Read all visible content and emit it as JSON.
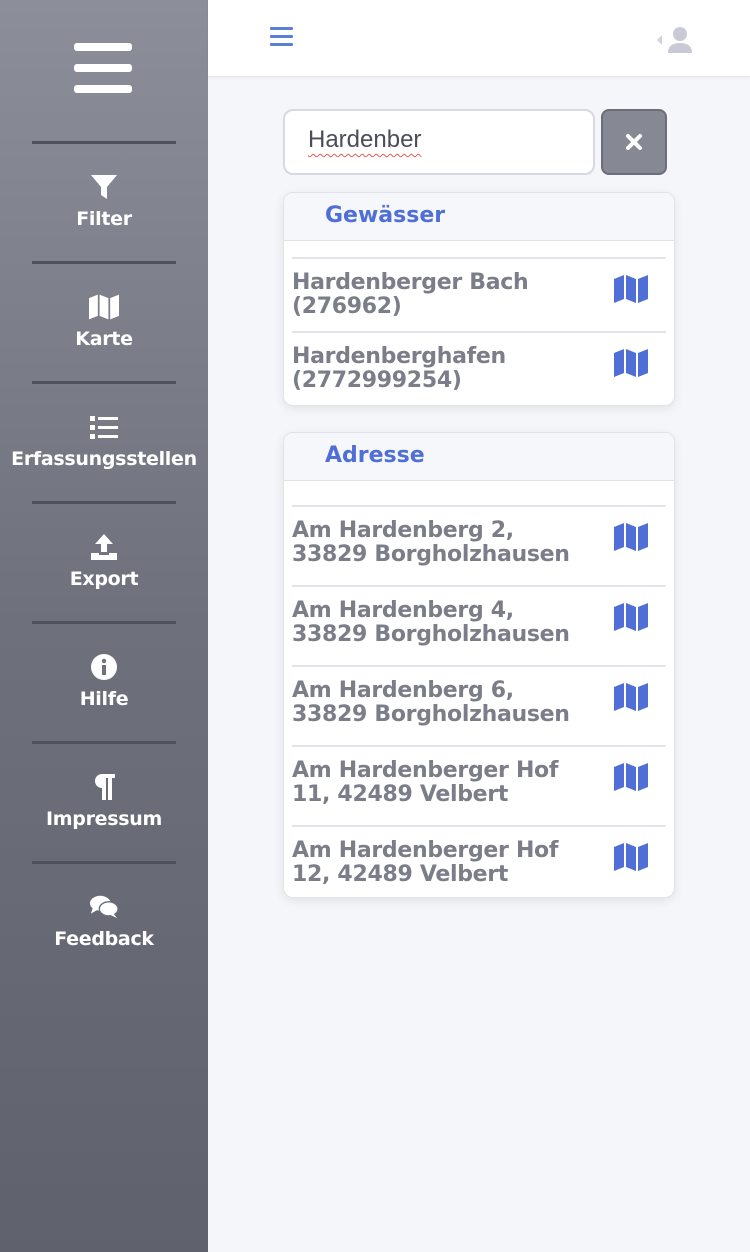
{
  "sidebar": {
    "items": [
      {
        "label": "Filter",
        "icon": "filter-icon"
      },
      {
        "label": "Karte",
        "icon": "map-icon"
      },
      {
        "label": "Erfassungsstellen",
        "icon": "list-icon"
      },
      {
        "label": "Export",
        "icon": "upload-icon"
      },
      {
        "label": "Hilfe",
        "icon": "info-icon"
      },
      {
        "label": "Impressum",
        "icon": "paragraph-icon"
      },
      {
        "label": "Feedback",
        "icon": "comments-icon"
      }
    ]
  },
  "search": {
    "value": "Hardenber"
  },
  "colors": {
    "accent": "#4f6fd6",
    "sidebar": "#6e707c",
    "result_text": "#7b7d89"
  },
  "groups": [
    {
      "title": "Gewässer",
      "results": [
        {
          "label": "Hardenberger Bach (276962)"
        },
        {
          "label": "Hardenberghafen (2772999254)"
        }
      ]
    },
    {
      "title": "Adresse",
      "results": [
        {
          "label": "Am Hardenberg 2, 33829 Borgholzhausen"
        },
        {
          "label": "Am Hardenberg 4, 33829 Borgholzhausen"
        },
        {
          "label": "Am Hardenberg 6, 33829 Borgholzhausen"
        },
        {
          "label": "Am Hardenberger Hof 11, 42489 Velbert"
        },
        {
          "label": "Am Hardenberger Hof 12, 42489 Velbert"
        }
      ]
    }
  ]
}
